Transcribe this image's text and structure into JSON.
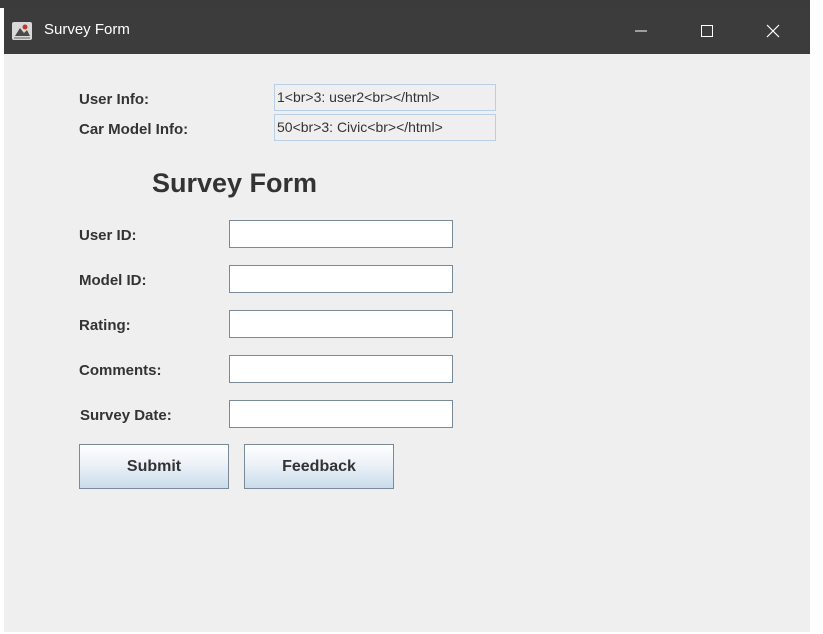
{
  "window": {
    "title": "Survey Form"
  },
  "info": {
    "user_label": "User Info:",
    "user_value": "1<br>3: user2<br></html>",
    "car_label": "Car Model Info:",
    "car_value": "50<br>3: Civic<br></html>"
  },
  "form": {
    "heading": "Survey Form",
    "fields": [
      {
        "label": "User ID:",
        "value": ""
      },
      {
        "label": "Model ID:",
        "value": ""
      },
      {
        "label": "Rating:",
        "value": ""
      },
      {
        "label": "Comments:",
        "value": ""
      },
      {
        "label": "Survey Date:",
        "value": ""
      }
    ],
    "submit_label": "Submit",
    "feedback_label": "Feedback"
  },
  "colors": {
    "titlebar": "#3c3c3c",
    "background": "#efefef",
    "text": "#333333",
    "info_border": "#b8cfe5"
  },
  "icons": {
    "app": "java-app-icon",
    "minimize": "minimize-icon",
    "maximize": "maximize-icon",
    "close": "close-icon"
  }
}
